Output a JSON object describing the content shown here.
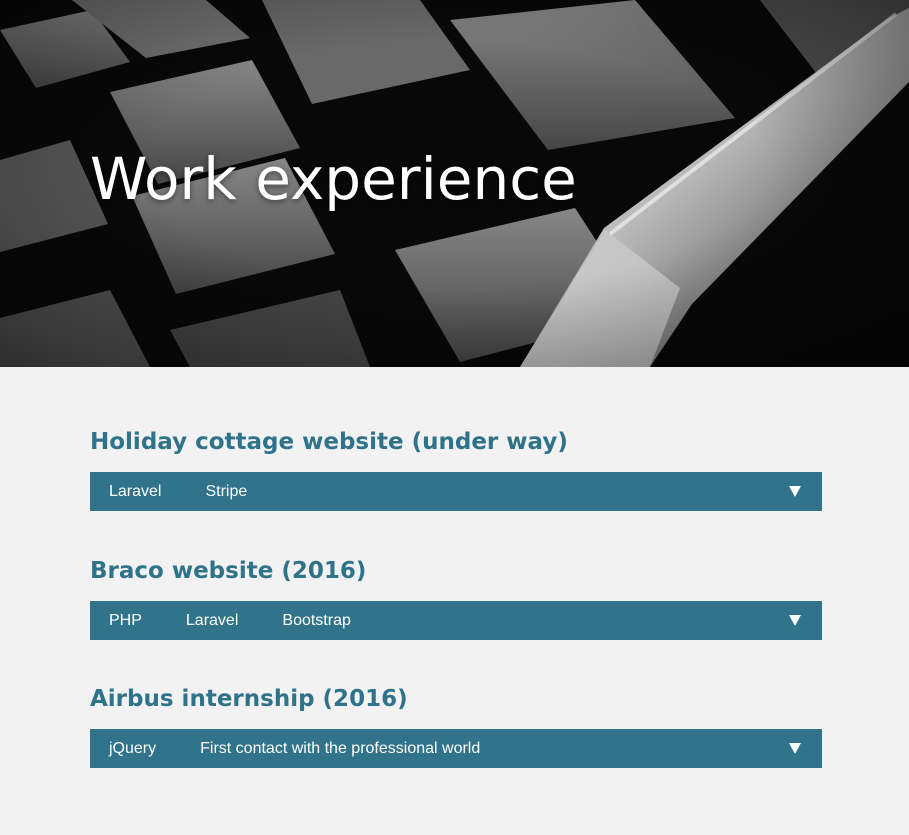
{
  "hero": {
    "title": "Work experience"
  },
  "projects": [
    {
      "title": "Holiday cottage website (under way)",
      "tags": [
        "Laravel",
        "Stripe"
      ],
      "toggle_icon": "triangle-down-icon"
    },
    {
      "title": "Braco website (2016)",
      "tags": [
        "PHP",
        "Laravel",
        "Bootstrap"
      ],
      "toggle_icon": "triangle-down-icon"
    },
    {
      "title": "Airbus internship (2016)",
      "tags": [
        "jQuery",
        "First contact with the professional world"
      ],
      "toggle_icon": "triangle-down-icon"
    }
  ],
  "colors": {
    "accent": "#2e7389",
    "bar": "#30738a",
    "page_background": "#f2f2f2"
  }
}
